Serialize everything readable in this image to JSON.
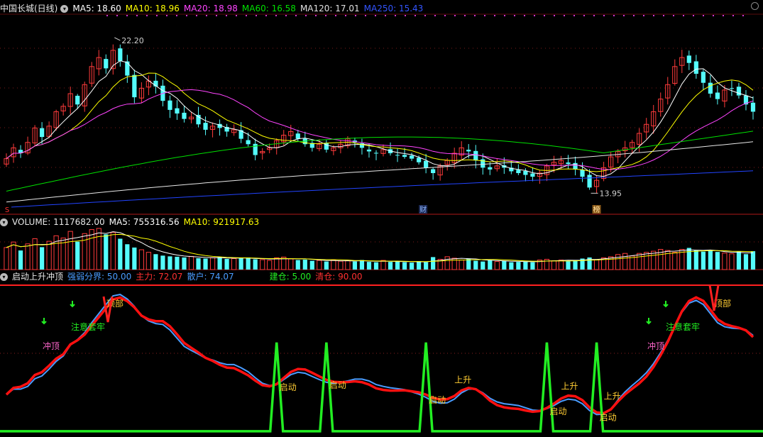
{
  "price_header": {
    "stock_title": "中国长城(日线)",
    "ma5": "MA5: 18.60",
    "ma10": "MA10: 18.96",
    "ma20": "MA20: 18.98",
    "ma60": "MA60: 16.58",
    "ma120": "MA120: 17.01",
    "ma250": "MA250: 15.43"
  },
  "volume_header": {
    "volume": "VOLUME: 1117682.00",
    "ma5": "MA5: 755316.56",
    "ma10": "MA10: 921917.63"
  },
  "indicator_header": {
    "name": "启动上升冲顶",
    "threshold": "强弱分界: 50.00",
    "main_force": "主力: 72.07",
    "retail": "散户: 74.07",
    "build": "建仓: 5.00",
    "clear": "清仓: 90.00"
  },
  "markers": {
    "high_label": "22.20",
    "low_label": "13.95",
    "s_marker": "S",
    "cai_marker": "财",
    "bang_marker": "榜"
  },
  "signals": {
    "qidong": "启动",
    "shangsheng": "上升",
    "chongding": "冲顶",
    "dingbu": "顶部",
    "zhuyi": "注意套牢"
  },
  "colors": {
    "up": "#ff3b3b",
    "down": "#54fcfc",
    "ma5": "#ffffff",
    "ma10": "#ffff00",
    "ma20": "#ff44ff",
    "ma60": "#00e000",
    "ma120": "#e8e8e8",
    "ma250": "#2244ff",
    "retail_line": "#4a9cff",
    "main_line": "#ff1010",
    "pulse": "#22ee22"
  },
  "chart_data": {
    "type": "candlestick",
    "ylim": [
      13.0,
      24.0
    ],
    "close": [
      16.0,
      16.6,
      16.3,
      16.9,
      17.7,
      17.2,
      17.8,
      18.6,
      18.9,
      19.6,
      19.0,
      20.1,
      21.1,
      21.6,
      21.0,
      22.0,
      21.4,
      20.6,
      19.4,
      19.9,
      20.3,
      20.0,
      19.2,
      18.7,
      18.5,
      18.2,
      18.3,
      17.9,
      17.6,
      17.8,
      17.7,
      17.5,
      17.6,
      17.1,
      16.8,
      16.2,
      16.4,
      16.6,
      17.0,
      17.3,
      17.5,
      17.1,
      16.8,
      16.6,
      16.8,
      16.5,
      16.6,
      16.8,
      17.1,
      16.9,
      16.6,
      16.4,
      16.3,
      16.5,
      16.3,
      16.2,
      16.1,
      16.0,
      15.8,
      15.5,
      15.2,
      15.6,
      15.9,
      16.3,
      16.6,
      16.4,
      15.9,
      15.5,
      15.4,
      15.6,
      15.5,
      15.3,
      15.2,
      15.1,
      15.0,
      15.2,
      15.6,
      15.8,
      15.9,
      15.7,
      15.4,
      15.0,
      14.4,
      14.8,
      15.5,
      16.1,
      16.4,
      16.6,
      16.9,
      17.4,
      17.9,
      18.6,
      19.3,
      20.1,
      21.1,
      21.6,
      21.3,
      20.7,
      20.2,
      19.6,
      19.3,
      19.8,
      19.9,
      19.5,
      19.0,
      18.6
    ],
    "volume": [
      6.0,
      7.5,
      5.2,
      7.0,
      8.4,
      6.1,
      7.7,
      9.2,
      8.6,
      10.4,
      7.6,
      9.8,
      10.9,
      11.2,
      9.6,
      10.1,
      8.4,
      6.9,
      6.0,
      5.4,
      4.7,
      4.2,
      3.8,
      3.6,
      3.5,
      3.3,
      3.6,
      3.1,
      3.0,
      3.2,
      3.4,
      2.9,
      3.0,
      3.1,
      3.3,
      2.8,
      2.7,
      2.5,
      3.2,
      3.4,
      2.9,
      2.6,
      2.7,
      2.4,
      2.5,
      2.2,
      2.6,
      2.3,
      2.4,
      2.2,
      2.6,
      2.1,
      2.0,
      2.5,
      2.1,
      2.3,
      2.0,
      1.9,
      2.3,
      2.0,
      3.4,
      2.8,
      3.5,
      3.1,
      2.6,
      2.9,
      2.4,
      2.2,
      2.6,
      2.2,
      2.4,
      2.0,
      2.1,
      2.2,
      2.0,
      2.6,
      2.8,
      2.4,
      2.6,
      2.3,
      2.5,
      3.0,
      3.3,
      2.6,
      3.2,
      3.5,
      4.1,
      4.4,
      3.7,
      4.4,
      4.7,
      5.0,
      5.5,
      5.2,
      4.7,
      5.5,
      5.9,
      5.2,
      4.9,
      5.1,
      4.8,
      4.5,
      4.3,
      4.9,
      4.2,
      5.0
    ]
  }
}
